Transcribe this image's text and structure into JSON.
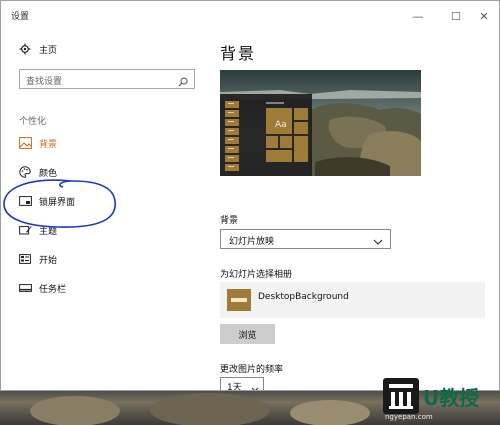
{
  "window": {
    "title": "设置",
    "controls": {
      "minimize": "—",
      "maximize": "☐",
      "close": "✕"
    }
  },
  "sidebar": {
    "home_label": "主页",
    "search_placeholder": "查找设置",
    "group_label": "个性化",
    "items": [
      {
        "label": "背景",
        "icon": "image-icon",
        "active": true
      },
      {
        "label": "颜色",
        "icon": "palette-icon",
        "active": false
      },
      {
        "label": "锁屏界面",
        "icon": "lock-screen-icon",
        "active": false
      },
      {
        "label": "主题",
        "icon": "theme-icon",
        "active": false
      },
      {
        "label": "开始",
        "icon": "start-icon",
        "active": false
      },
      {
        "label": "任务栏",
        "icon": "taskbar-icon",
        "active": false
      }
    ]
  },
  "main": {
    "title": "背景",
    "preview_tile_text": "Aa",
    "background_label": "背景",
    "background_value": "幻灯片放映",
    "album_label": "为幻灯片选择相册",
    "album_name": "DesktopBackground",
    "browse_label": "浏览",
    "frequency_label": "更改图片的频率",
    "frequency_value": "1天"
  },
  "colors": {
    "accent": "#c56a1b",
    "tile": "#9e7c37",
    "annotation": "#1f36c9"
  },
  "watermark": {
    "text": "U教授",
    "url": "ngyepan.com"
  }
}
